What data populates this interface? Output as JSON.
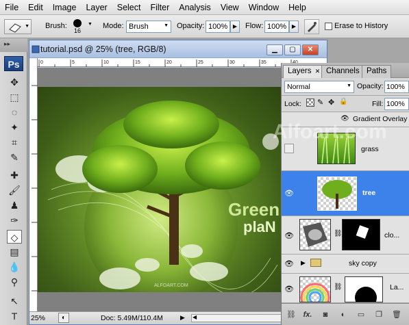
{
  "menu": [
    "File",
    "Edit",
    "Image",
    "Layer",
    "Select",
    "Filter",
    "Analysis",
    "View",
    "Window",
    "Help"
  ],
  "options": {
    "brush_label": "Brush:",
    "brush_size": "16",
    "mode_label": "Mode:",
    "mode_value": "Brush",
    "opacity_label": "Opacity:",
    "opacity_value": "100%",
    "flow_label": "Flow:",
    "flow_value": "100%",
    "erase_history_label": "Erase to History"
  },
  "toolbox": {
    "logo": "Ps"
  },
  "document": {
    "title": "tutorial.psd @ 25% (tree, RGB/8)",
    "ruler_marks": [
      "0",
      "5",
      "10",
      "15",
      "20",
      "25",
      "30",
      "35",
      "40"
    ],
    "artwork_text_green": "Green",
    "artwork_text_plan": "plaN",
    "artwork_watermark": "ALFOART.COM",
    "background_watermark": "Alfoart.com",
    "zoom": "25%",
    "doc_info": "Doc: 5.49M/110.4M"
  },
  "layers_panel": {
    "tabs": [
      "Layers",
      "Channels",
      "Paths"
    ],
    "blend_mode": "Normal",
    "opacity_label": "Opacity:",
    "opacity_value": "100%",
    "lock_label": "Lock:",
    "fill_label": "Fill:",
    "fill_value": "100%",
    "effect_label": "Gradient Overlay",
    "layers": [
      {
        "name": "grass"
      },
      {
        "name": "tree"
      },
      {
        "name": "clo..."
      },
      {
        "name": "sky copy"
      },
      {
        "name": "La..."
      }
    ],
    "bottom_fx": "fx."
  },
  "colors": {
    "selection_blue": "#3d82ea",
    "ps_blue": "#1b3f7a",
    "tree_green": "#6fae1c"
  }
}
